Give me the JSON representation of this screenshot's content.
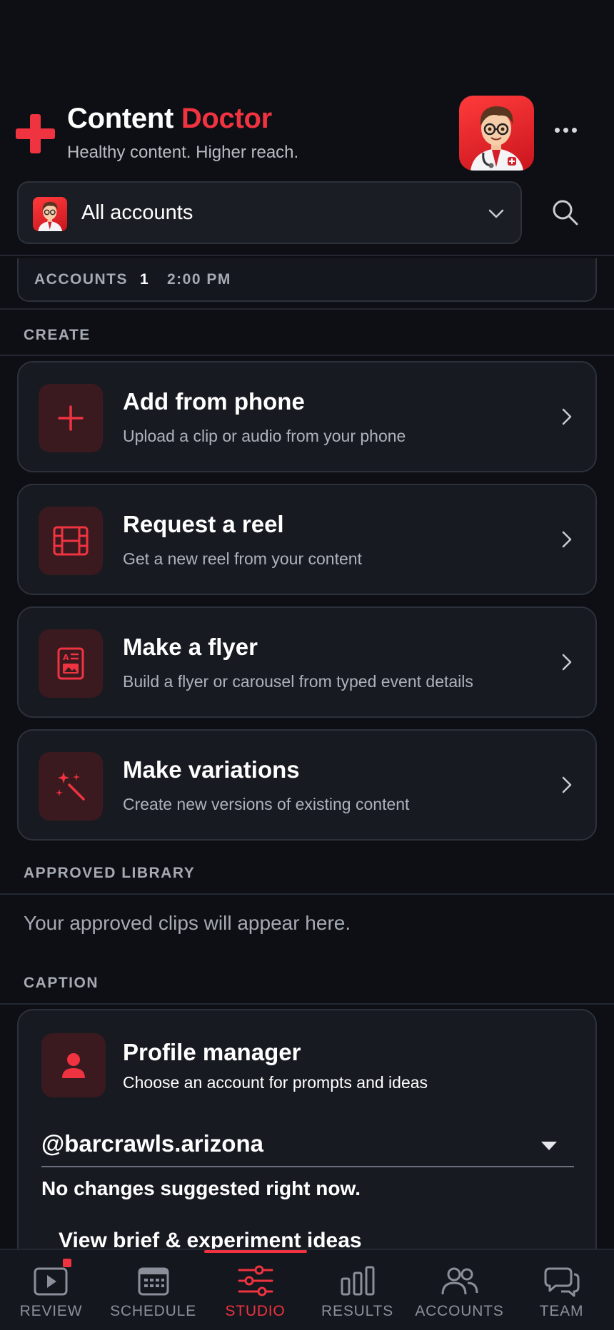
{
  "brand": {
    "title_part1": "Content",
    "title_part2": "Doctor",
    "tagline": "Healthy content. Higher reach."
  },
  "account_selector": {
    "label": "All accounts"
  },
  "stats": {
    "accounts_label": "ACCOUNTS",
    "accounts_count": "1",
    "time": "2:00 PM"
  },
  "create": {
    "section_label": "CREATE",
    "items": [
      {
        "title": "Add from phone",
        "subtitle": "Upload a clip or audio from your phone",
        "icon": "plus-icon"
      },
      {
        "title": "Request a reel",
        "subtitle": "Get a new reel from your content",
        "icon": "film-icon"
      },
      {
        "title": "Make a flyer",
        "subtitle": "Build a flyer or carousel from typed event details",
        "icon": "flyer-icon"
      },
      {
        "title": "Make variations",
        "subtitle": "Create new versions of existing content",
        "icon": "magic-wand-icon"
      }
    ]
  },
  "approved_library": {
    "section_label": "APPROVED LIBRARY",
    "empty_text": "Your approved clips will appear here."
  },
  "caption": {
    "section_label": "CAPTION",
    "title": "Profile manager",
    "subtitle": "Choose an account for prompts and ideas",
    "selected_handle": "@barcrawls.arizona",
    "status": "No changes suggested right now.",
    "link": "View brief & experiment ideas"
  },
  "bottom_nav": {
    "active": "STUDIO",
    "items": [
      {
        "label": "REVIEW",
        "icon": "play-icon"
      },
      {
        "label": "SCHEDULE",
        "icon": "calendar-icon"
      },
      {
        "label": "STUDIO",
        "icon": "sliders-icon"
      },
      {
        "label": "RESULTS",
        "icon": "bar-chart-icon"
      },
      {
        "label": "ACCOUNTS",
        "icon": "users-icon"
      },
      {
        "label": "TEAM",
        "icon": "chat-icon"
      }
    ]
  },
  "colors": {
    "accent": "#ef3340",
    "background": "#0d0f14",
    "card": "#171a21",
    "icon_tile": "#3a1a1f"
  }
}
